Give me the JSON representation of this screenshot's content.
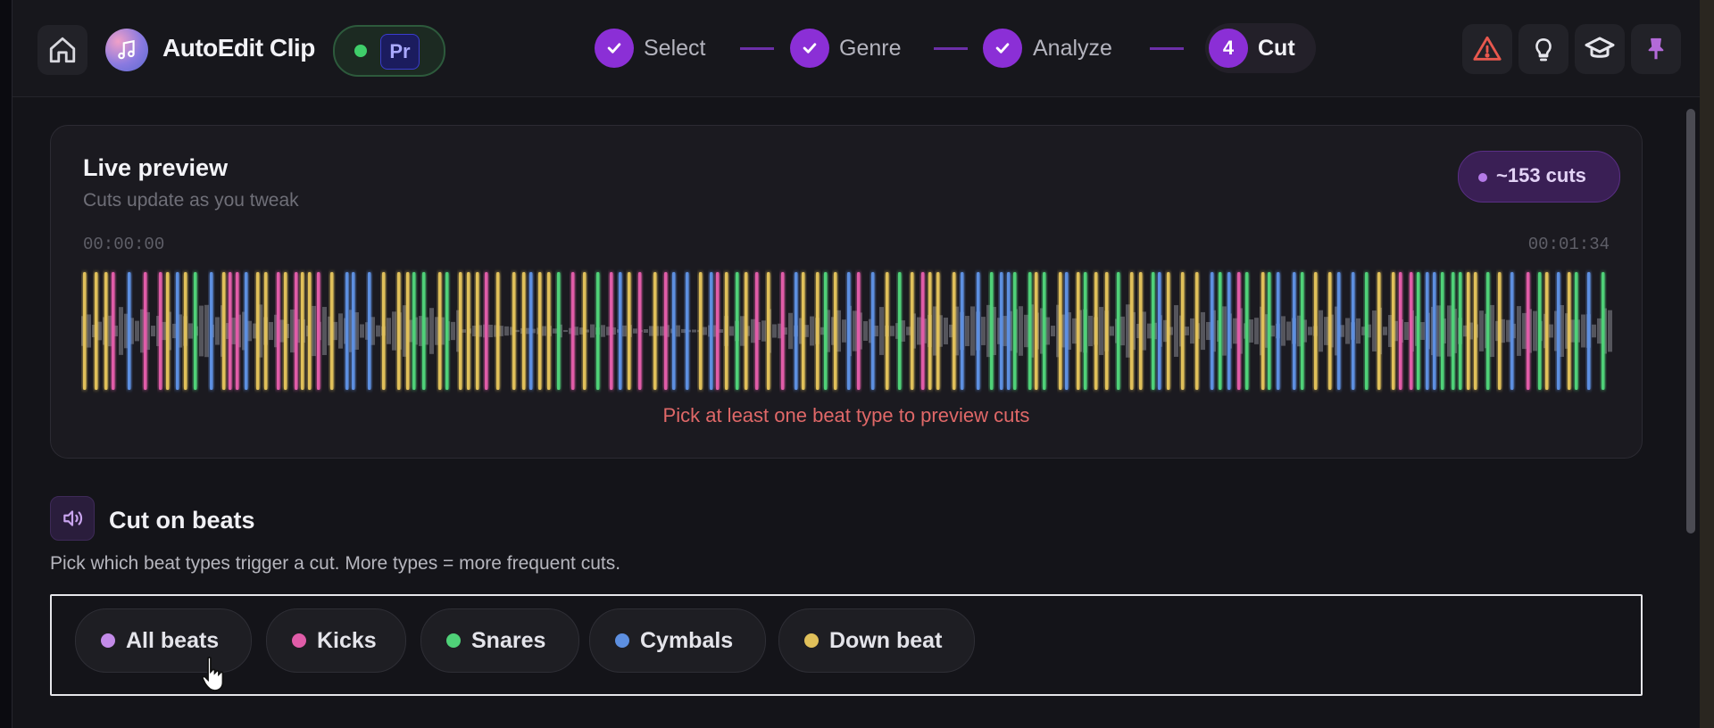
{
  "app": {
    "title": "AutoEdit Clip",
    "host_badge": "Pr"
  },
  "steps": [
    {
      "label": "Select",
      "state": "done"
    },
    {
      "label": "Genre",
      "state": "done"
    },
    {
      "label": "Analyze",
      "state": "done"
    },
    {
      "label": "Cut",
      "state": "active",
      "number": "4"
    }
  ],
  "header_icons": [
    "warning-icon",
    "lightbulb-icon",
    "graduation-cap-icon",
    "pin-icon"
  ],
  "preview": {
    "title": "Live preview",
    "subtitle": "Cuts update as you tweak",
    "cuts_badge": "~153  cuts",
    "time_start": "00:00:00",
    "time_end": "00:01:34",
    "message": "Pick at least one beat type to preview cuts"
  },
  "beats": {
    "title": "Cut on beats",
    "description": "Pick which beat types trigger a cut. More types = more frequent cuts.",
    "chips": [
      {
        "label": "All beats",
        "color": "#c38be8"
      },
      {
        "label": "Kicks",
        "color": "#e05ca8"
      },
      {
        "label": "Snares",
        "color": "#4fd178"
      },
      {
        "label": "Cymbals",
        "color": "#5d8fe0"
      },
      {
        "label": "Down beat",
        "color": "#e0c05a"
      }
    ]
  },
  "colors": {
    "accent": "#8b2fd6",
    "kick": "#e05ca8",
    "snare": "#4fd178",
    "cymbal": "#5d8fe0",
    "downbeat": "#e0c05a",
    "error": "#e06868"
  }
}
